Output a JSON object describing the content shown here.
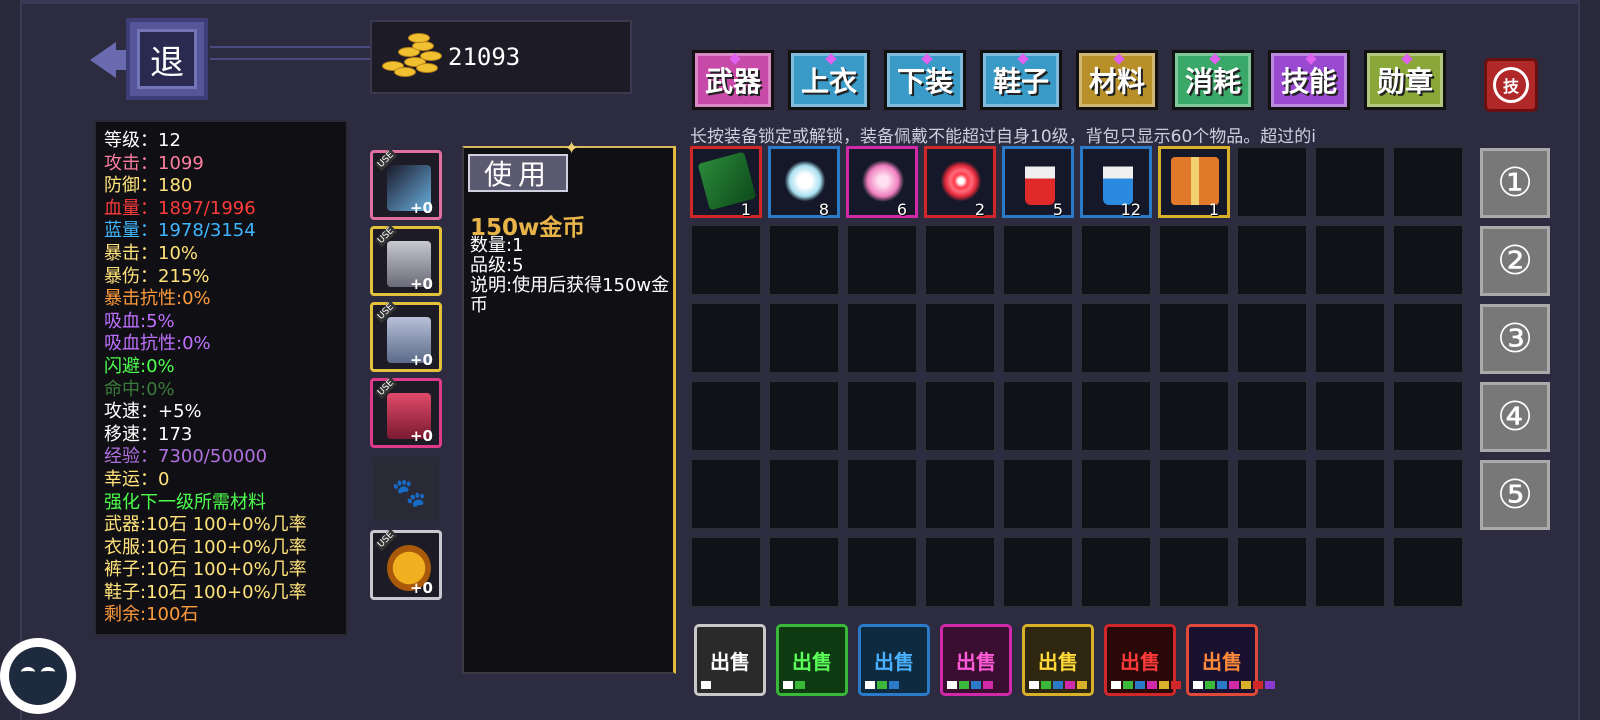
{
  "header": {
    "back_label": "退",
    "gold": "21093"
  },
  "tabs": [
    {
      "label": "武器",
      "bg": "#c84aa8"
    },
    {
      "label": "上衣",
      "bg": "#3a9ac8"
    },
    {
      "label": "下装",
      "bg": "#3a9ac8"
    },
    {
      "label": "鞋子",
      "bg": "#3a9ac8"
    },
    {
      "label": "材料",
      "bg": "#b8902a"
    },
    {
      "label": "消耗",
      "bg": "#3aa868"
    },
    {
      "label": "技能",
      "bg": "#9a4ad0"
    },
    {
      "label": "勋章",
      "bg": "#8aa83a"
    }
  ],
  "refresh_label": "技",
  "hint": "长按装备锁定或解锁，装备佩戴不能超过自身10级，背包只显示60个物品。超过的i",
  "stats": [
    {
      "text": "等级：12",
      "color": "#ffffff"
    },
    {
      "text": "攻击：1099",
      "color": "#ff7fa0"
    },
    {
      "text": "防御：180",
      "color": "#ffe27a"
    },
    {
      "text": "血量：1897/1996",
      "color": "#ff3b3b"
    },
    {
      "text": "蓝量：1978/3154",
      "color": "#3fb6ff"
    },
    {
      "text": "暴击：10%",
      "color": "#ffe27a"
    },
    {
      "text": "暴伤：215%",
      "color": "#ffe27a"
    },
    {
      "text": "暴击抗性:0%",
      "color": "#ff9a3a"
    },
    {
      "text": "吸血:5%",
      "color": "#c070ff"
    },
    {
      "text": "吸血抗性:0%",
      "color": "#c070ff"
    },
    {
      "text": "闪避:0%",
      "color": "#4dff4d"
    },
    {
      "text": "命中:0%",
      "color": "#3a7a3a"
    },
    {
      "text": "攻速：+5%",
      "color": "#ffffff"
    },
    {
      "text": "移速：173",
      "color": "#ffffff"
    },
    {
      "text": "经验：7300/50000",
      "color": "#b070e0"
    },
    {
      "text": "幸运：0",
      "color": "#ffe27a"
    },
    {
      "text": "强化下一级所需材料",
      "color": "#4dff4d"
    },
    {
      "text": "武器:10石 100+0%几率",
      "color": "#ffe27a"
    },
    {
      "text": "衣服:10石 100+0%几率",
      "color": "#ffe27a"
    },
    {
      "text": "裤子:10石 100+0%几率",
      "color": "#ffe27a"
    },
    {
      "text": "鞋子:10石 100+0%几率",
      "color": "#ffe27a"
    },
    {
      "text": "剩余:100石",
      "color": "#ff9a3a"
    }
  ],
  "equipment": [
    {
      "slot": "weapon",
      "icon": "bow-icon",
      "border": "#e070a0",
      "plus": "+0",
      "use": "USE"
    },
    {
      "slot": "armor",
      "icon": "chestplate-icon",
      "border": "#e2c23a",
      "plus": "+0",
      "use": "USE"
    },
    {
      "slot": "pants",
      "icon": "leg-armor-icon",
      "border": "#e2c23a",
      "plus": "+0",
      "use": "USE"
    },
    {
      "slot": "boots",
      "icon": "boots-icon",
      "border": "#e03a8a",
      "plus": "+0",
      "use": "USE"
    },
    {
      "slot": "pet",
      "icon": "paw-icon",
      "border": "#2c2b40",
      "plus": "",
      "use": ""
    },
    {
      "slot": "skill",
      "icon": "fist-icon",
      "border": "#c8c8d0",
      "plus": "+0",
      "use": "USE"
    }
  ],
  "detail": {
    "header": "使用",
    "title": "150w金币",
    "lines": [
      "数量:1",
      "品级:5",
      "说明:使用后获得150w金币"
    ]
  },
  "inventory": [
    {
      "icon": "green-book-icon",
      "count": "1",
      "border": "#d02828"
    },
    {
      "icon": "white-orb-icon",
      "count": "8",
      "border": "#2a7ac8"
    },
    {
      "icon": "pink-orb-icon",
      "count": "6",
      "border": "#d02aa8"
    },
    {
      "icon": "red-orb-icon",
      "count": "2",
      "border": "#d02828"
    },
    {
      "icon": "red-potion-icon",
      "count": "5",
      "border": "#2a7ac8"
    },
    {
      "icon": "blue-potion-icon",
      "count": "12",
      "border": "#2a7ac8"
    },
    {
      "icon": "gift-box-icon",
      "count": "1",
      "border": "#d8b02a"
    }
  ],
  "pages": [
    "①",
    "②",
    "③",
    "④",
    "⑤"
  ],
  "sell_buttons": [
    {
      "label": "出售",
      "border": "#c8c8c8",
      "text": "#ffffff",
      "bg": "#2a2a2a",
      "dots": [
        "#ffffff"
      ]
    },
    {
      "label": "出售",
      "border": "#3ab83a",
      "text": "#5aff5a",
      "bg": "#0e3a12",
      "dots": [
        "#ffffff",
        "#3ab83a"
      ]
    },
    {
      "label": "出售",
      "border": "#2a7ac8",
      "text": "#4ab0ff",
      "bg": "#0e2a3e",
      "dots": [
        "#ffffff",
        "#3ab83a",
        "#2a7ac8"
      ]
    },
    {
      "label": "出售",
      "border": "#d02aa8",
      "text": "#ff5ad8",
      "bg": "#3a0e30",
      "dots": [
        "#ffffff",
        "#3ab83a",
        "#2a7ac8",
        "#d02aa8"
      ]
    },
    {
      "label": "出售",
      "border": "#d8b02a",
      "text": "#ffd83a",
      "bg": "#2e260e",
      "dots": [
        "#ffffff",
        "#3ab83a",
        "#2a7ac8",
        "#d02aa8",
        "#d8b02a"
      ]
    },
    {
      "label": "出售",
      "border": "#d02828",
      "text": "#ff3a3a",
      "bg": "#2a0808",
      "dots": [
        "#ffffff",
        "#3ab83a",
        "#2a7ac8",
        "#d02aa8",
        "#d8b02a",
        "#d02828"
      ]
    },
    {
      "label": "出售",
      "border": "#e04a3a",
      "text": "#ff8a3a",
      "bg": "#1a1030",
      "dots": [
        "#ffffff",
        "#3ab83a",
        "#2a7ac8",
        "#d02aa8",
        "#d8b02a",
        "#d02828",
        "#8a3ad0"
      ]
    }
  ]
}
